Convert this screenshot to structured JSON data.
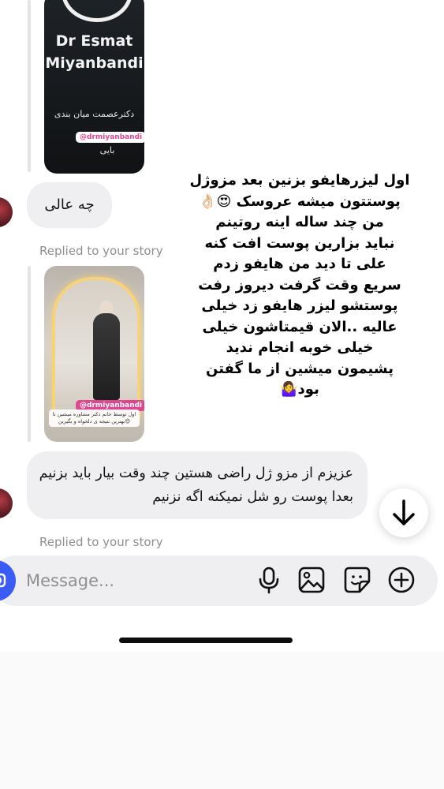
{
  "story_top": {
    "brand_line1": "Dr Esmat",
    "brand_line2": "Miyanbandi",
    "persian_name": "دکترعصمت میان بندی",
    "persian_sub": "بایی",
    "handle": "@drmiyanbandi"
  },
  "messages": [
    {
      "text": "چه عالی"
    },
    {
      "text": "عزیزم از مزو ژل راضی هستین چند وقت بیار باید بزنیم بعدا پوست رو شل نمیکنه اگه نزنیم"
    }
  ],
  "replied_label": "Replied to your story",
  "story_bottom": {
    "handle": "@drmiyanbandi",
    "caption": "اول توسط خانم دکتر مشاوره میشین تا بهترین نتیجه ی دلخواه و بگیرین😍"
  },
  "story_text": "اول لیزرهایفو بزنین بعد مزوژل\nپوستتون میشه عروسک 😍👌🏻\nمن چند ساله اینه روتینم\nنباید بزارین پوست افت کنه\nعلی تا دید من هایفو زدم\nسریع وقت گرفت دیروز رفت\nپوستشو لیزر هایفو زد خیلی\nعالیه ..الان قیمتاشون خیلی\nخیلی خوبه انجام ندید\nپشیمون میشین از ما گفتن\nبود🤷‍♀️",
  "composer": {
    "placeholder": "Message...",
    "icons": [
      "camera-icon",
      "microphone-icon",
      "gallery-icon",
      "sticker-icon",
      "add-icon"
    ]
  },
  "scroll_button_icon": "arrow-down-icon"
}
